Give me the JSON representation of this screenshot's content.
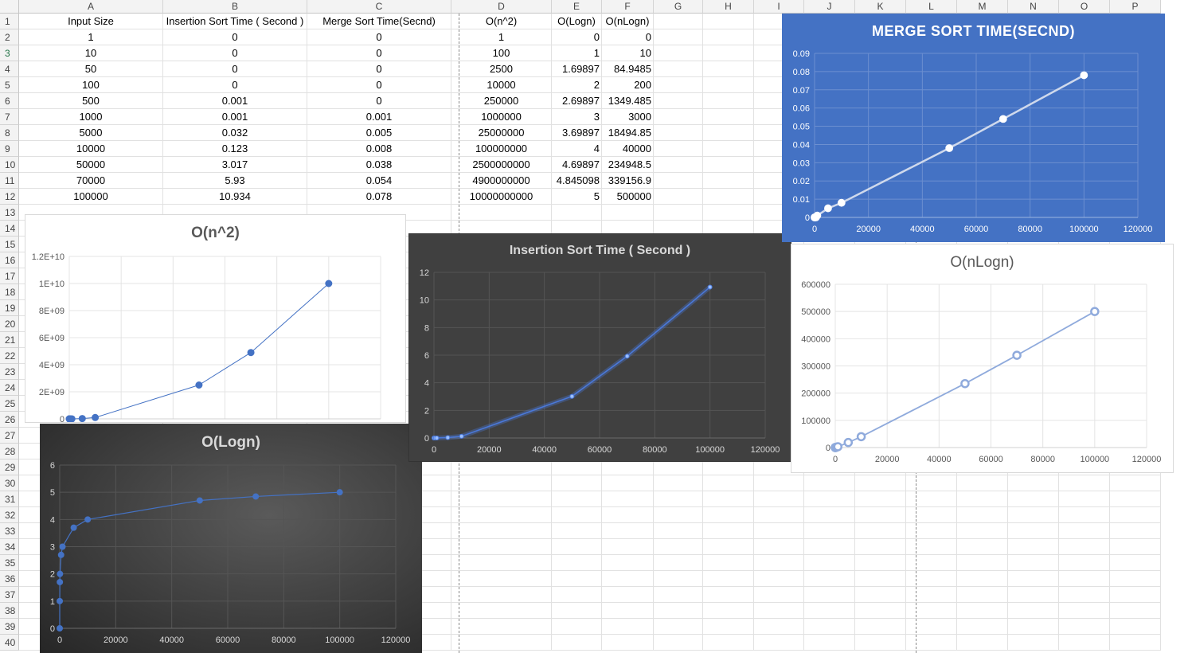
{
  "sheet": {
    "columns": [
      "A",
      "B",
      "C",
      "D",
      "E",
      "F",
      "G",
      "H",
      "I",
      "J",
      "K",
      "L",
      "M",
      "N",
      "O",
      "P"
    ],
    "rows": [
      "1",
      "2",
      "3",
      "4",
      "5",
      "6",
      "7",
      "8",
      "9",
      "10",
      "11",
      "12",
      "13",
      "14",
      "15",
      "16",
      "17",
      "18",
      "19",
      "20",
      "21",
      "22",
      "23",
      "24",
      "25",
      "26",
      "27",
      "28",
      "29",
      "30",
      "31",
      "32",
      "33",
      "34",
      "35",
      "36",
      "37",
      "38",
      "39",
      "40"
    ],
    "selected_row": "3",
    "headers": [
      "Input Size",
      "Insertion Sort Time ( Second )",
      "Merge Sort Time(Secnd)",
      "O(n^2)",
      "O(Logn)",
      "O(nLogn)"
    ],
    "table": [
      [
        "1",
        "0",
        "0",
        "1",
        "0",
        "0"
      ],
      [
        "10",
        "0",
        "0",
        "100",
        "1",
        "10"
      ],
      [
        "50",
        "0",
        "0",
        "2500",
        "1.69897",
        "84.9485"
      ],
      [
        "100",
        "0",
        "0",
        "10000",
        "2",
        "200"
      ],
      [
        "500",
        "0.001",
        "0",
        "250000",
        "2.69897",
        "1349.485"
      ],
      [
        "1000",
        "0.001",
        "0.001",
        "1000000",
        "3",
        "3000"
      ],
      [
        "5000",
        "0.032",
        "0.005",
        "25000000",
        "3.69897",
        "18494.85"
      ],
      [
        "10000",
        "0.123",
        "0.008",
        "100000000",
        "4",
        "40000"
      ],
      [
        "50000",
        "3.017",
        "0.038",
        "2500000000",
        "4.69897",
        "234948.5"
      ],
      [
        "70000",
        "5.93",
        "0.054",
        "4900000000",
        "4.845098",
        "339156.9"
      ],
      [
        "100000",
        "10.934",
        "0.078",
        "10000000000",
        "5",
        "500000"
      ]
    ]
  },
  "chart_data": [
    {
      "id": "merge",
      "type": "scatter",
      "title": "MERGE SORT TIME(SECND)",
      "x": [
        1,
        10,
        50,
        100,
        500,
        1000,
        5000,
        10000,
        50000,
        70000,
        100000
      ],
      "y": [
        0,
        0,
        0,
        0,
        0,
        0.001,
        0.005,
        0.008,
        0.038,
        0.054,
        0.078
      ],
      "xlim": [
        0,
        120000
      ],
      "ylim": [
        0,
        0.09
      ],
      "xticks": [
        "0",
        "20000",
        "40000",
        "60000",
        "80000",
        "100000",
        "120000"
      ],
      "yticks": [
        "0",
        "0.01",
        "0.02",
        "0.03",
        "0.04",
        "0.05",
        "0.06",
        "0.07",
        "0.08",
        "0.09"
      ],
      "grid": true,
      "colors": {
        "bg": "#4472c4",
        "line": "#cfd9ec",
        "marker_fill": "#ffffff",
        "text": "#ffffff"
      }
    },
    {
      "id": "n2",
      "type": "scatter",
      "title": "O(n^2)",
      "x": [
        1,
        10,
        50,
        100,
        500,
        1000,
        5000,
        10000,
        50000,
        70000,
        100000
      ],
      "y": [
        1,
        100,
        2500,
        10000,
        250000,
        1000000,
        25000000,
        100000000,
        2500000000,
        4900000000,
        10000000000
      ],
      "xlim": [
        0,
        120000
      ],
      "ylim": [
        0,
        12000000000
      ],
      "yticks": [
        "0",
        "2E+09",
        "4E+09",
        "6E+09",
        "8E+09",
        "1E+10",
        "1.2E+10"
      ],
      "grid": true,
      "colors": {
        "bg": "#ffffff",
        "line": "#4472c4",
        "marker_fill": "#4472c4",
        "text": "#595959"
      }
    },
    {
      "id": "insertion",
      "type": "scatter",
      "title": "Insertion Sort Time ( Second )",
      "x": [
        1,
        10,
        50,
        100,
        500,
        1000,
        5000,
        10000,
        50000,
        70000,
        100000
      ],
      "y": [
        0,
        0,
        0,
        0,
        0.001,
        0.001,
        0.032,
        0.123,
        3.017,
        5.93,
        10.934
      ],
      "xlim": [
        0,
        120000
      ],
      "ylim": [
        0,
        12
      ],
      "xticks": [
        "0",
        "20000",
        "40000",
        "60000",
        "80000",
        "100000",
        "120000"
      ],
      "yticks": [
        "0",
        "2",
        "4",
        "6",
        "8",
        "10",
        "12"
      ],
      "grid": true,
      "colors": {
        "bg": "#404040",
        "line": "#4a78d8",
        "marker_fill": "#9cc0ff",
        "text": "#d9d9d9"
      }
    },
    {
      "id": "nlogn",
      "type": "scatter",
      "title": "O(nLogn)",
      "x": [
        1,
        10,
        50,
        100,
        500,
        1000,
        5000,
        10000,
        50000,
        70000,
        100000
      ],
      "y": [
        0,
        10,
        84.9485,
        200,
        1349.485,
        3000,
        18494.85,
        40000,
        234948.5,
        339156.9,
        500000
      ],
      "xlim": [
        0,
        120000
      ],
      "ylim": [
        0,
        600000
      ],
      "xticks": [
        "0",
        "20000",
        "40000",
        "60000",
        "80000",
        "100000",
        "120000"
      ],
      "yticks": [
        "0",
        "100000",
        "200000",
        "300000",
        "400000",
        "500000",
        "600000"
      ],
      "grid": true,
      "colors": {
        "bg": "#ffffff",
        "line": "#8faadc",
        "marker_fill": "#ffffff",
        "text": "#595959"
      }
    },
    {
      "id": "logn",
      "type": "scatter",
      "title": "O(Logn)",
      "x": [
        1,
        10,
        50,
        100,
        500,
        1000,
        5000,
        10000,
        50000,
        70000,
        100000
      ],
      "y": [
        0,
        1,
        1.69897,
        2,
        2.69897,
        3,
        3.69897,
        4,
        4.69897,
        4.845098,
        5
      ],
      "xlim": [
        0,
        120000
      ],
      "ylim": [
        0,
        6
      ],
      "xticks": [
        "0",
        "20000",
        "40000",
        "60000",
        "80000",
        "100000",
        "120000"
      ],
      "yticks": [
        "0",
        "1",
        "2",
        "3",
        "4",
        "5",
        "6"
      ],
      "grid": true,
      "colors": {
        "bg": "#3a3a3a",
        "line": "#4472c4",
        "marker_fill": "#4472c4",
        "text": "#d9d9d9"
      }
    }
  ]
}
